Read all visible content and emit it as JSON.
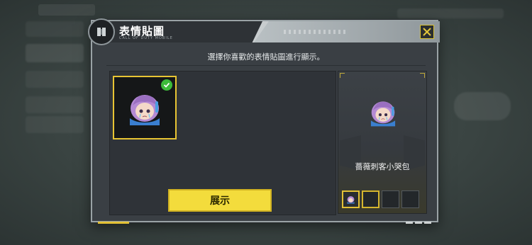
{
  "dialog": {
    "title": "表情貼圖",
    "subtitle": "CALL OF DUTY MOBILE",
    "instruction": "選擇你喜歡的表情貼圖進行顯示。",
    "show_button": "展示",
    "preview_name": "薔薇刺客小哭包"
  },
  "colors": {
    "accent": "#f3dc3c",
    "selected_border": "#e8c433",
    "check": "#3dbb3a"
  },
  "icons": [
    "cod-logo-icon",
    "close-icon",
    "check-icon",
    "sticker-crying-assassin"
  ]
}
